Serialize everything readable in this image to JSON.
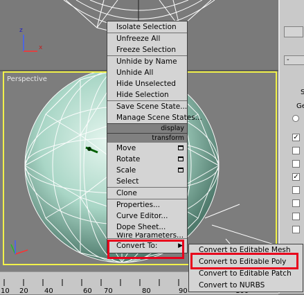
{
  "viewports": {
    "perspective_label": "Perspective",
    "axis_x": "x",
    "axis_y": "y",
    "axis_z": "z"
  },
  "quad_menu": {
    "display_items": [
      "Isolate Selection",
      "Unfreeze All",
      "Freeze Selection",
      "Unhide by Name",
      "Unhide All",
      "Hide Unselected",
      "Hide Selection",
      "Save Scene State...",
      "Manage Scene States..."
    ],
    "display_title": "display",
    "transform_title": "transform",
    "transform_items": [
      "Move",
      "Rotate",
      "Scale",
      "Select",
      "Clone",
      "Properties...",
      "Curve Editor...",
      "Dope Sheet...",
      "Wire Parameters...",
      "Convert To:"
    ]
  },
  "convert_submenu": {
    "items": [
      "Convert to Editable Mesh",
      "Convert to Editable Poly",
      "Convert to Editable Patch",
      "Convert to NURBS"
    ],
    "highlighted": "Convert to Editable Poly"
  },
  "command_panel": {
    "rollout_label": "-",
    "group_letter": "S",
    "group_label": "Ge",
    "checkbox_mark": "✓"
  },
  "ruler": {
    "ticks": [
      "10",
      "20",
      "40",
      "60",
      "70",
      "80",
      "90",
      "100"
    ]
  },
  "colors": {
    "viewport_active_border": "#f2f24a",
    "highlight": "#e8001c",
    "menu_bg": "#d4d4d4"
  }
}
